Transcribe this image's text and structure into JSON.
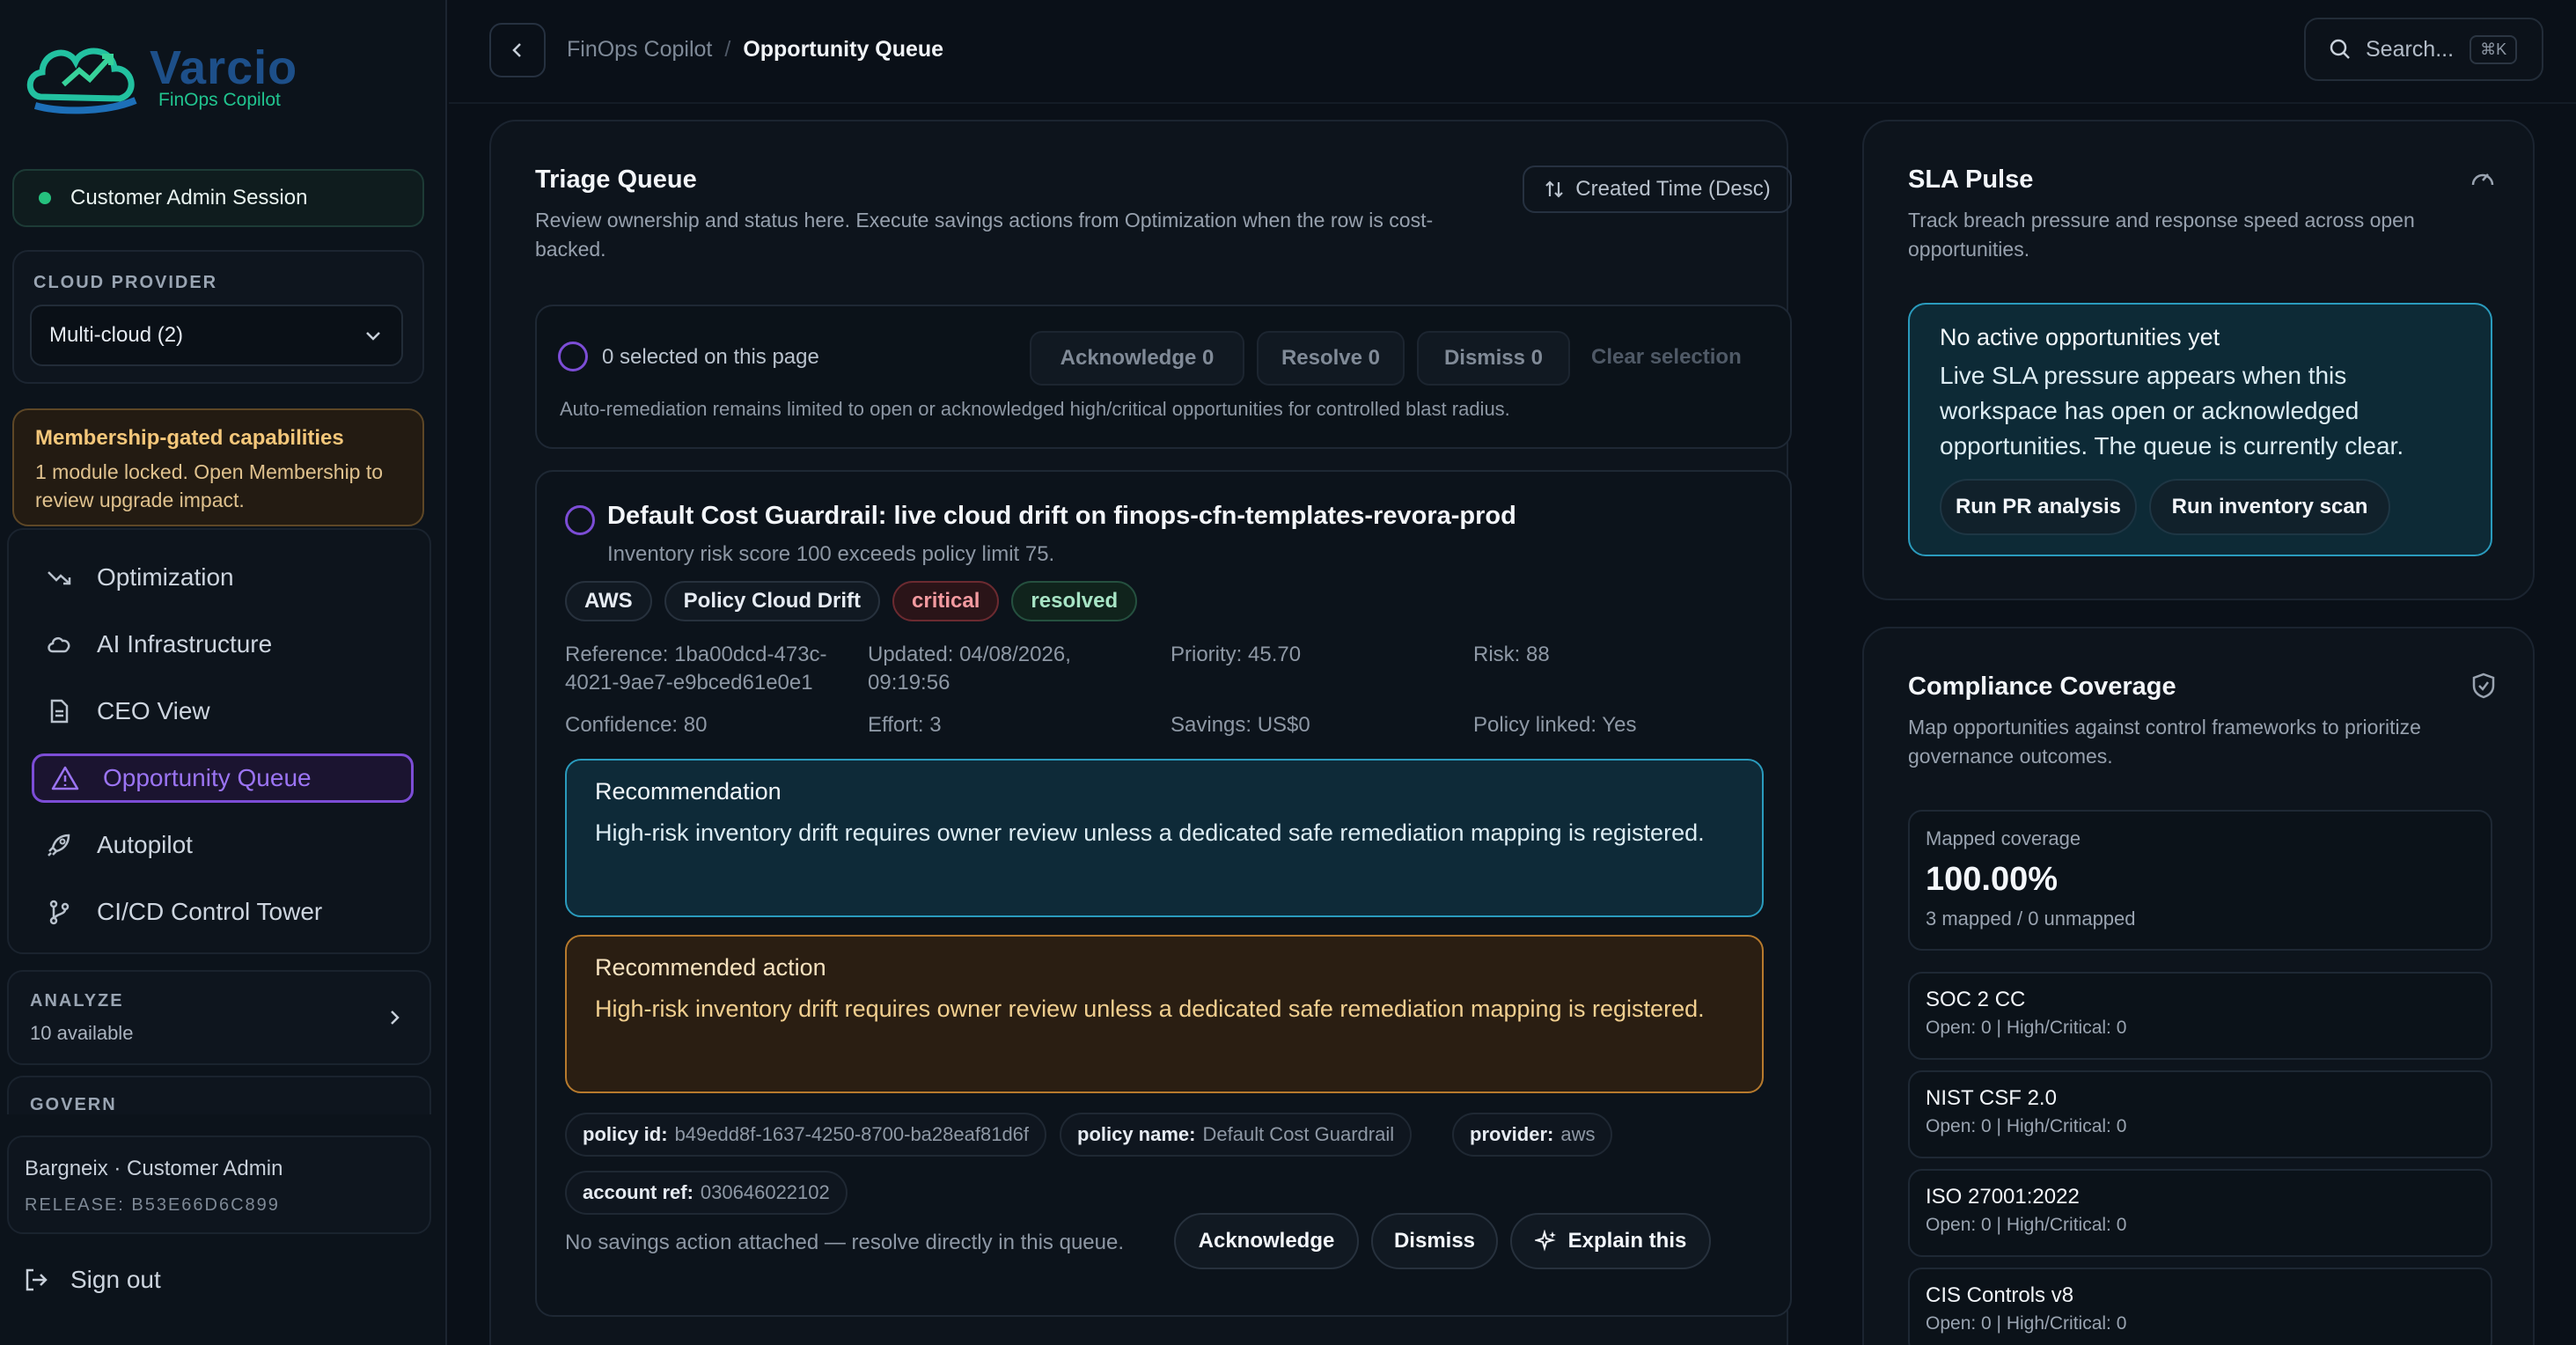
{
  "brand": {
    "name": "Varcio",
    "subtitle": "FinOps Copilot"
  },
  "sidebar": {
    "session": "Customer Admin Session",
    "provider_label": "CLOUD PROVIDER",
    "provider_value": "Multi-cloud (2)",
    "membership": {
      "title": "Membership-gated capabilities",
      "text": "1 module locked. Open Membership to review upgrade impact."
    },
    "nav": [
      {
        "label": "Optimization",
        "icon": "trend-down-icon"
      },
      {
        "label": "AI Infrastructure",
        "icon": "cloud-icon"
      },
      {
        "label": "CEO View",
        "icon": "document-icon"
      },
      {
        "label": "Opportunity Queue",
        "icon": "warning-icon",
        "active": true
      },
      {
        "label": "Autopilot",
        "icon": "rocket-icon"
      },
      {
        "label": "CI/CD Control Tower",
        "icon": "git-branch-icon"
      }
    ],
    "analyze": {
      "title": "ANALYZE",
      "sub": "10 available"
    },
    "govern": {
      "title": "GOVERN"
    },
    "user": {
      "name": "Bargneix · Customer Admin",
      "release": "RELEASE: B53E66D6C899"
    },
    "signout": "Sign out"
  },
  "topbar": {
    "crumb_parent": "FinOps Copilot",
    "crumb_sep": "/",
    "crumb_current": "Opportunity Queue",
    "search_placeholder": "Search...",
    "search_shortcut": "⌘K"
  },
  "triage": {
    "title": "Triage Queue",
    "subtitle": "Review ownership and status here. Execute savings actions from Optimization when the row is cost-backed.",
    "sort_label": "Created Time (Desc)",
    "bulk": {
      "selected": "0 selected on this page",
      "acknowledge": "Acknowledge 0",
      "resolve": "Resolve 0",
      "dismiss": "Dismiss 0",
      "clear": "Clear selection",
      "note": "Auto-remediation remains limited to open or acknowledged high/critical opportunities for controlled blast radius."
    },
    "card": {
      "title": "Default Cost Guardrail: live cloud drift on finops-cfn-templates-revora-prod",
      "subtitle": "Inventory risk score 100 exceeds policy limit 75.",
      "chips": [
        "AWS",
        "Policy Cloud Drift",
        "critical",
        "resolved"
      ],
      "meta": {
        "reference": "Reference: 1ba00dcd-473c-4021-9ae7-e9bced61e0e1",
        "updated": "Updated: 04/08/2026, 09:19:56",
        "priority": "Priority: 45.70",
        "risk": "Risk: 88",
        "confidence": "Confidence: 80",
        "effort": "Effort: 3",
        "savings": "Savings: US$0",
        "policy_linked": "Policy linked: Yes"
      },
      "recommendation": {
        "title": "Recommendation",
        "text": "High-risk inventory drift requires owner review unless a dedicated safe remediation mapping is registered."
      },
      "recommended_action": {
        "title": "Recommended action",
        "text": "High-risk inventory drift requires owner review unless a dedicated safe remediation mapping is registered."
      },
      "tags": [
        {
          "key": "policy id:",
          "value": "b49edd8f-1637-4250-8700-ba28eaf81d6f"
        },
        {
          "key": "policy name:",
          "value": "Default Cost Guardrail"
        },
        {
          "key": "provider:",
          "value": "aws"
        },
        {
          "key": "account ref:",
          "value": "030646022102"
        }
      ],
      "footnote": "No savings action attached — resolve directly in this queue.",
      "actions": {
        "acknowledge": "Acknowledge",
        "dismiss": "Dismiss",
        "explain": "Explain this"
      }
    }
  },
  "sla": {
    "title": "SLA Pulse",
    "subtitle": "Track breach pressure and response speed across open opportunities.",
    "empty_title": "No active opportunities yet",
    "empty_text": "Live SLA pressure appears when this workspace has open or acknowledged opportunities. The queue is currently clear.",
    "btn_pr": "Run PR analysis",
    "btn_inventory": "Run inventory scan"
  },
  "compliance": {
    "title": "Compliance Coverage",
    "subtitle": "Map opportunities against control frameworks to prioritize governance outcomes.",
    "coverage_label": "Mapped coverage",
    "coverage_value": "100.00%",
    "coverage_sub": "3 mapped / 0 unmapped",
    "frameworks": [
      {
        "name": "SOC 2 CC",
        "stat": "Open: 0 | High/Critical: 0"
      },
      {
        "name": "NIST CSF 2.0",
        "stat": "Open: 0 | High/Critical: 0"
      },
      {
        "name": "ISO 27001:2022",
        "stat": "Open: 0 | High/Critical: 0"
      },
      {
        "name": "CIS Controls v8",
        "stat": "Open: 0 | High/Critical: 0"
      }
    ]
  },
  "colors": {
    "accent": "#7c4dd6",
    "info": "#2a9bbd",
    "warn": "#b77a2d",
    "success": "#25c17e"
  }
}
